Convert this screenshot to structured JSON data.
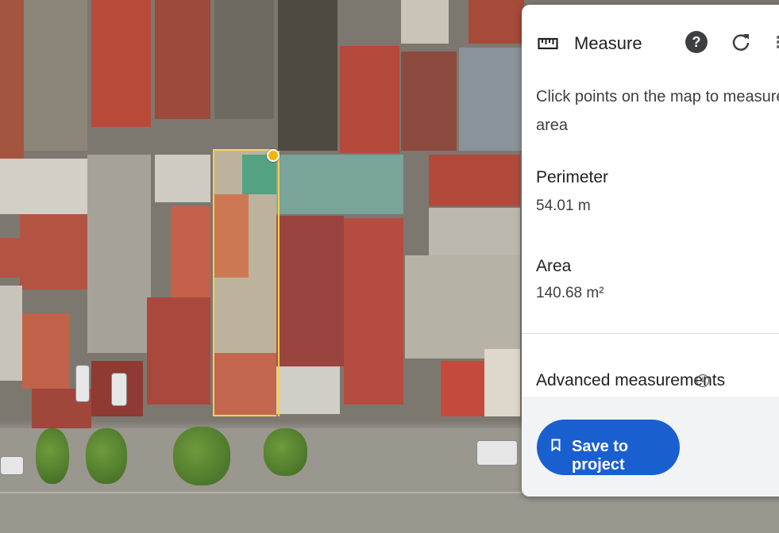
{
  "panel": {
    "title": "Measure",
    "icons": {
      "ruler": "ruler-icon",
      "help": "help-icon",
      "reset": "reset-icon",
      "more": "more-vert-icon"
    },
    "help_glyph": "?",
    "instructions_line1": "Click points on the map to measure distar",
    "instructions_line2": "area",
    "perimeter_label": "Perimeter",
    "perimeter_value": "54.01 m",
    "area_label": "Area",
    "area_value": "140.68 m²",
    "advanced_label": "Advanced measurements",
    "info_glyph": "i",
    "save_button": "Save to project"
  },
  "colors": {
    "accent": "#1a5fd0",
    "selection": "#f1cf52",
    "vertex": "#f4b400"
  }
}
